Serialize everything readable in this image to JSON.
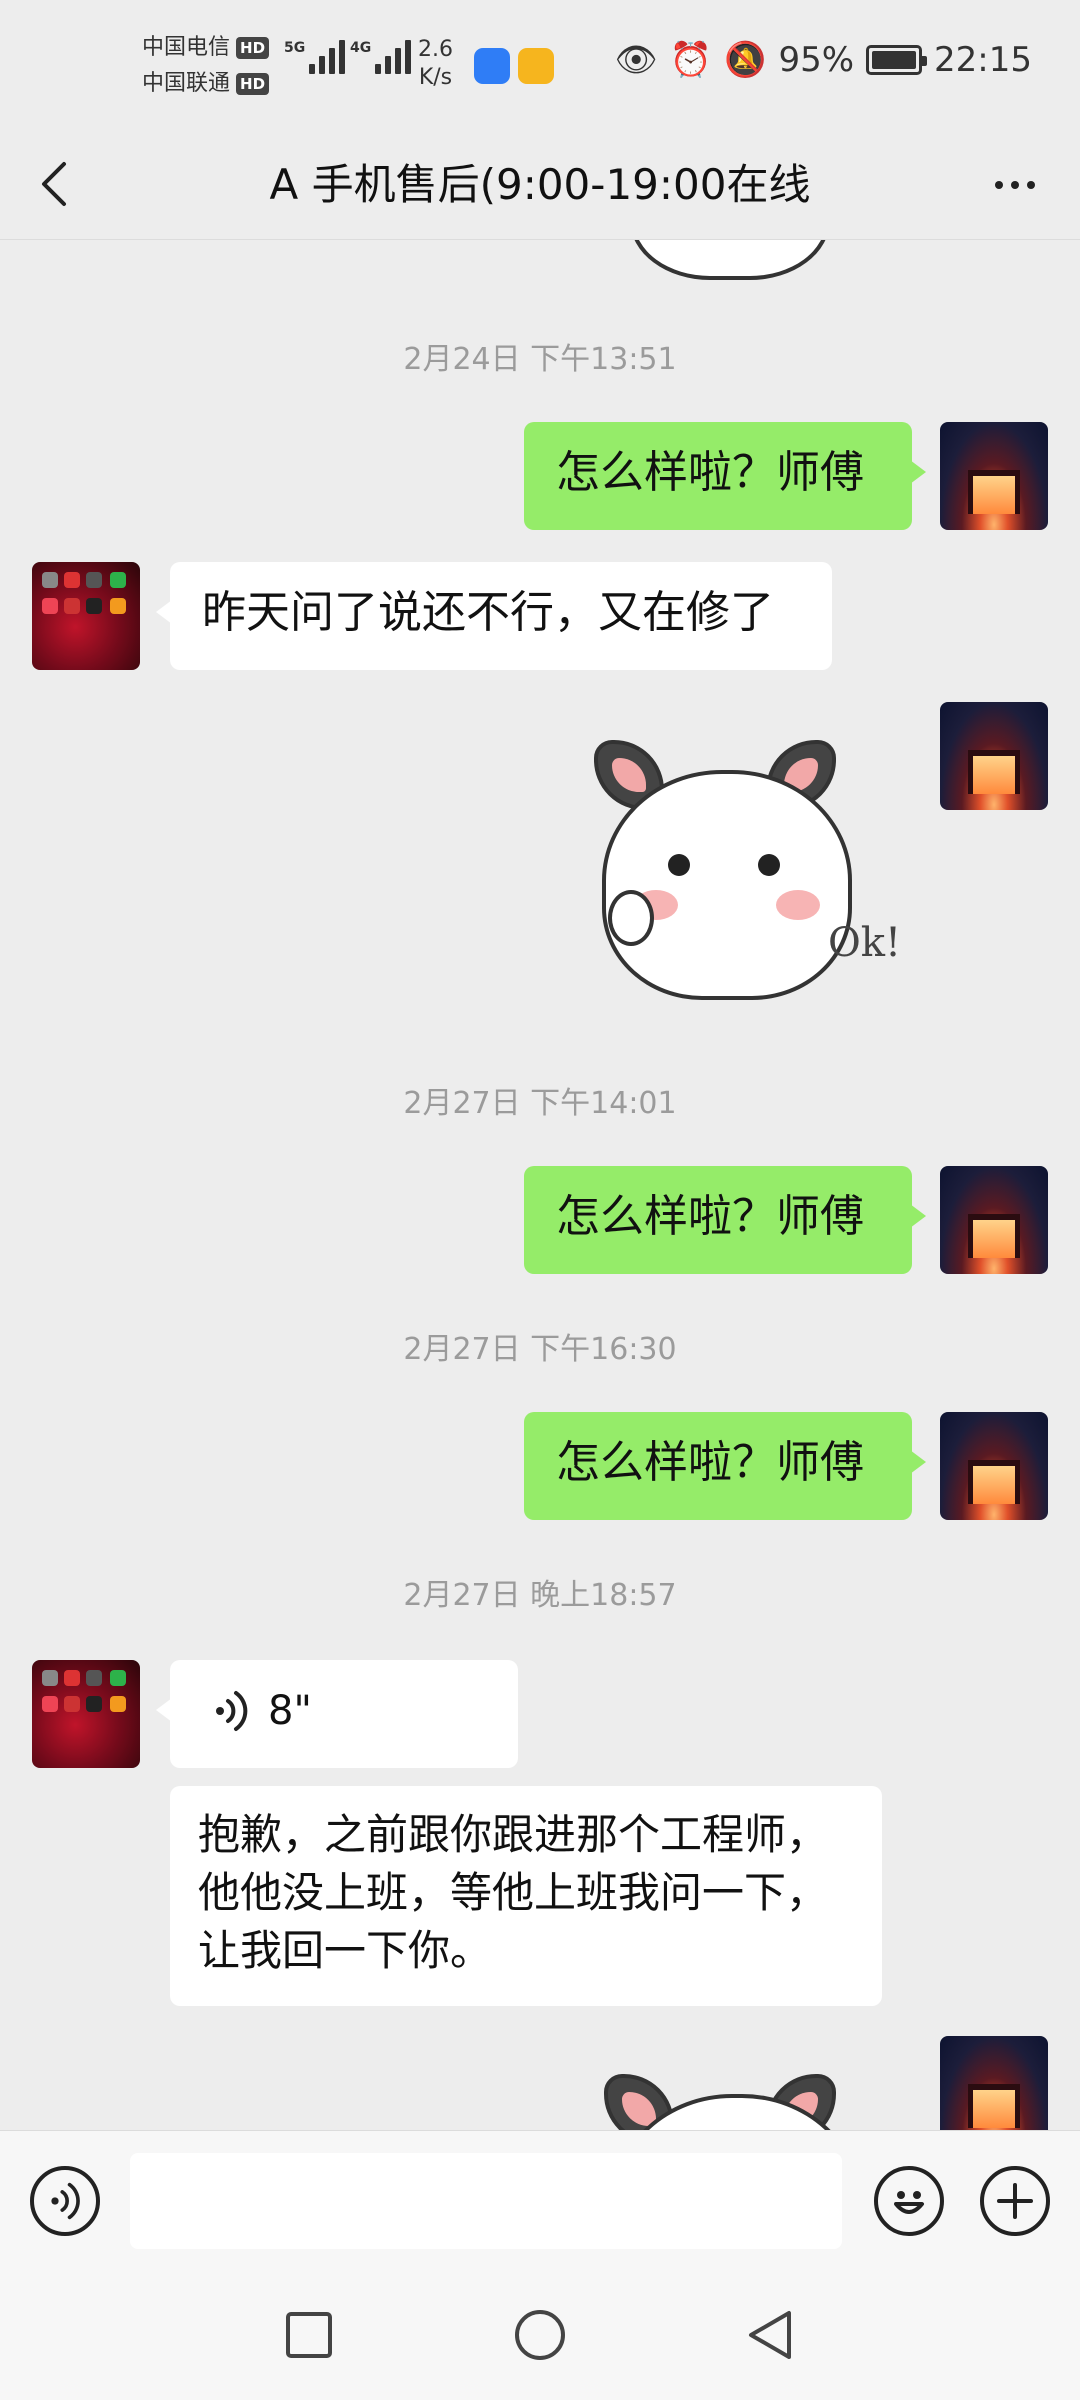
{
  "status_bar": {
    "carrier1": "中国电信",
    "carrier2": "中国联通",
    "hd_label": "HD",
    "net1": "5G",
    "net2": "4G",
    "speed_value": "2.6",
    "speed_unit": "K/s",
    "battery": "95%",
    "time": "22:15"
  },
  "header": {
    "title": "A 手机售后(9:00-19:00在线"
  },
  "chat": {
    "timestamps": [
      "2月24日 下午13:51",
      "2月27日 下午14:01",
      "2月27日 下午16:30",
      "2月27日 晚上18:57"
    ],
    "messages": [
      {
        "sender": "me",
        "text": "怎么样啦？师傅"
      },
      {
        "sender": "other",
        "text": "昨天问了说还不行，又在修了"
      },
      {
        "sender": "me",
        "type": "sticker",
        "sticker_text": "Ok!"
      },
      {
        "sender": "me",
        "text": "怎么样啦？师傅"
      },
      {
        "sender": "me",
        "text": "怎么样啦？师傅"
      },
      {
        "sender": "other",
        "type": "voice",
        "duration": "8\""
      },
      {
        "sender": "other",
        "text": "抱歉，之前跟你跟进那个工程师，他他没上班，等他上班我问一下，让我回一下你。"
      },
      {
        "sender": "me",
        "type": "sticker"
      }
    ]
  },
  "input": {
    "value": "",
    "placeholder": ""
  },
  "colors": {
    "background": "#ededed",
    "bubble_me": "#95ec69",
    "bubble_other": "#ffffff",
    "timestamp": "#9b9b9b"
  }
}
